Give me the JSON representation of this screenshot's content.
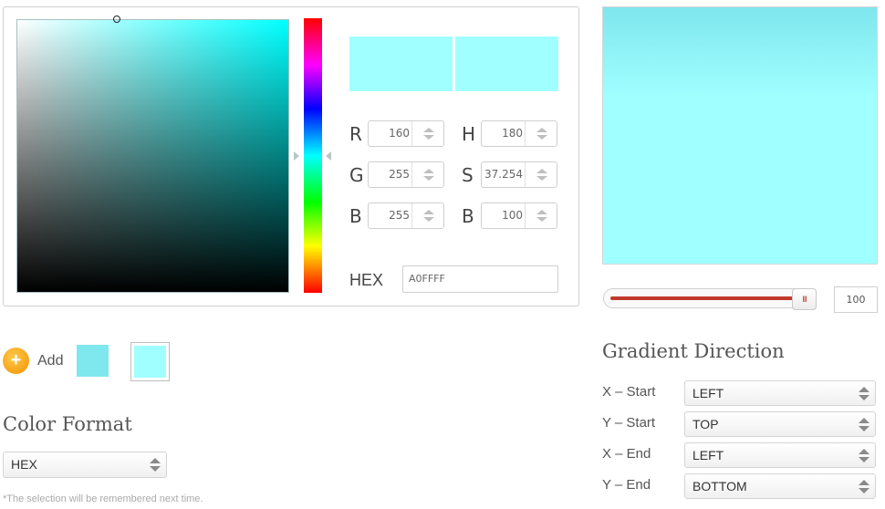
{
  "picker": {
    "rgb": {
      "r": "160",
      "g": "255",
      "b": "255"
    },
    "hsb": {
      "h": "180",
      "s": "37.254",
      "b": "100"
    },
    "labels": {
      "r": "R",
      "g": "G",
      "b": "B",
      "h": "H",
      "s": "S",
      "bri": "B",
      "hex": "HEX"
    },
    "hex_value": "A0FFFF",
    "colors": {
      "selected": "#a0ffff",
      "hue": "#00ffff"
    }
  },
  "opacity": {
    "value": "100",
    "handle_glyph": "III",
    "fill_color": "#c0392b"
  },
  "saved_colors": {
    "add_label": "Add",
    "swatches": [
      "#7fe7ee",
      "#a0ffff"
    ]
  },
  "color_format": {
    "heading": "Color Format",
    "selected": "HEX",
    "note": "*The selection will be remembered next time."
  },
  "gradient": {
    "heading": "Gradient Direction",
    "colors": {
      "start": "#7fe6ee",
      "end": "#a0ffff"
    },
    "rows": [
      {
        "label": "X – Start",
        "value": "LEFT"
      },
      {
        "label": "Y – Start",
        "value": "TOP"
      },
      {
        "label": "X – End",
        "value": "LEFT"
      },
      {
        "label": "Y – End",
        "value": "BOTTOM"
      }
    ]
  },
  "icons": {
    "add": "plus-circle-icon"
  }
}
